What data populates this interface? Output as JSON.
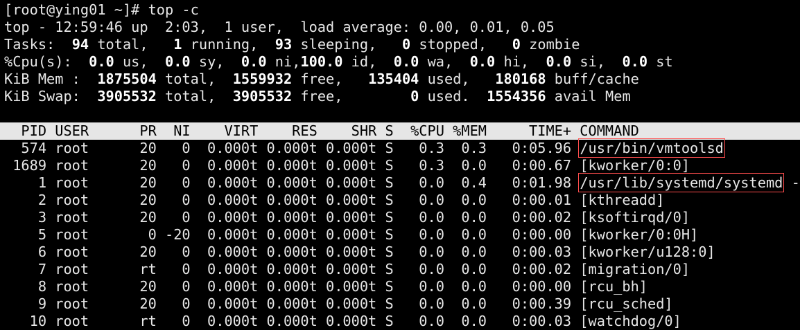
{
  "prompt": {
    "text": "[root@ying01 ~]# top -c"
  },
  "summary": {
    "uptime_line": {
      "prefix": "top - 12:59:46 up  2:03,  1 user,  load average: 0.00, 0.01, 0.05"
    },
    "tasks": {
      "label": "Tasks:",
      "total_val": "94",
      "total_lbl": " total,",
      "running_val": "1",
      "running_lbl": " running,",
      "sleeping_val": "93",
      "sleeping_lbl": " sleeping,",
      "stopped_val": "0",
      "stopped_lbl": " stopped,",
      "zombie_val": "0",
      "zombie_lbl": " zombie"
    },
    "cpu": {
      "label": "%Cpu(s):",
      "us_val": "0.0",
      "us_lbl": " us,",
      "sy_val": "0.0",
      "sy_lbl": " sy,",
      "ni_val": "0.0",
      "ni_lbl": " ni,",
      "id_val": "100.0",
      "id_lbl": " id,",
      "wa_val": "0.0",
      "wa_lbl": " wa,",
      "hi_val": "0.0",
      "hi_lbl": " hi,",
      "si_val": "0.0",
      "si_lbl": " si,",
      "st_val": "0.0",
      "st_lbl": " st"
    },
    "mem": {
      "label": "KiB Mem :",
      "total_val": "1875504",
      "total_lbl": " total,",
      "free_val": "1559932",
      "free_lbl": " free,",
      "used_val": "135404",
      "used_lbl": " used,",
      "buff_val": "180168",
      "buff_lbl": " buff/cache"
    },
    "swap": {
      "label": "KiB Swap:",
      "total_val": "3905532",
      "total_lbl": " total,",
      "free_val": "3905532",
      "free_lbl": " free,",
      "used_val": "0",
      "used_lbl": " used.",
      "avail_val": "1554356",
      "avail_lbl": " avail Mem"
    }
  },
  "table": {
    "header": "  PID USER      PR  NI    VIRT    RES    SHR S  %CPU %MEM     TIME+ COMMAND",
    "rows": [
      {
        "pid": "574",
        "user": "root",
        "pr": "20",
        "ni": "0",
        "virt": "0.000t",
        "res": "0.000t",
        "shr": "0.000t",
        "s": "S",
        "cpu": "0.3",
        "mem": "0.3",
        "time": "0:05.96",
        "command": "/usr/bin/vmtoolsd",
        "extra": ""
      },
      {
        "pid": "1689",
        "user": "root",
        "pr": "20",
        "ni": "0",
        "virt": "0.000t",
        "res": "0.000t",
        "shr": "0.000t",
        "s": "S",
        "cpu": "0.3",
        "mem": "0.0",
        "time": "0:00.67",
        "command": "[kworker/0:0]",
        "extra": ""
      },
      {
        "pid": "1",
        "user": "root",
        "pr": "20",
        "ni": "0",
        "virt": "0.000t",
        "res": "0.000t",
        "shr": "0.000t",
        "s": "S",
        "cpu": "0.0",
        "mem": "0.4",
        "time": "0:01.98",
        "command": "/usr/lib/systemd/systemd",
        "extra": " --s"
      },
      {
        "pid": "2",
        "user": "root",
        "pr": "20",
        "ni": "0",
        "virt": "0.000t",
        "res": "0.000t",
        "shr": "0.000t",
        "s": "S",
        "cpu": "0.0",
        "mem": "0.0",
        "time": "0:00.01",
        "command": "[kthreadd]",
        "extra": ""
      },
      {
        "pid": "3",
        "user": "root",
        "pr": "20",
        "ni": "0",
        "virt": "0.000t",
        "res": "0.000t",
        "shr": "0.000t",
        "s": "S",
        "cpu": "0.0",
        "mem": "0.0",
        "time": "0:00.02",
        "command": "[ksoftirqd/0]",
        "extra": ""
      },
      {
        "pid": "5",
        "user": "root",
        "pr": "0",
        "ni": "-20",
        "virt": "0.000t",
        "res": "0.000t",
        "shr": "0.000t",
        "s": "S",
        "cpu": "0.0",
        "mem": "0.0",
        "time": "0:00.00",
        "command": "[kworker/0:0H]",
        "extra": ""
      },
      {
        "pid": "6",
        "user": "root",
        "pr": "20",
        "ni": "0",
        "virt": "0.000t",
        "res": "0.000t",
        "shr": "0.000t",
        "s": "S",
        "cpu": "0.0",
        "mem": "0.0",
        "time": "0:00.03",
        "command": "[kworker/u128:0]",
        "extra": ""
      },
      {
        "pid": "7",
        "user": "root",
        "pr": "rt",
        "ni": "0",
        "virt": "0.000t",
        "res": "0.000t",
        "shr": "0.000t",
        "s": "S",
        "cpu": "0.0",
        "mem": "0.0",
        "time": "0:00.02",
        "command": "[migration/0]",
        "extra": ""
      },
      {
        "pid": "8",
        "user": "root",
        "pr": "20",
        "ni": "0",
        "virt": "0.000t",
        "res": "0.000t",
        "shr": "0.000t",
        "s": "S",
        "cpu": "0.0",
        "mem": "0.0",
        "time": "0:00.00",
        "command": "[rcu_bh]",
        "extra": ""
      },
      {
        "pid": "9",
        "user": "root",
        "pr": "20",
        "ni": "0",
        "virt": "0.000t",
        "res": "0.000t",
        "shr": "0.000t",
        "s": "S",
        "cpu": "0.0",
        "mem": "0.0",
        "time": "0:00.39",
        "command": "[rcu_sched]",
        "extra": ""
      },
      {
        "pid": "10",
        "user": "root",
        "pr": "rt",
        "ni": "0",
        "virt": "0.000t",
        "res": "0.000t",
        "shr": "0.000t",
        "s": "S",
        "cpu": "0.0",
        "mem": "0.0",
        "time": "0:00.03",
        "command": "[watchdog/0]",
        "extra": ""
      }
    ],
    "highlighted_commands": [
      "/usr/bin/vmtoolsd",
      "/usr/lib/systemd/systemd"
    ]
  },
  "colors": {
    "background": "#000000",
    "text": "#e6e6e6",
    "header_bg": "#e6e6e6",
    "highlight_box": "#ff4d4d"
  }
}
